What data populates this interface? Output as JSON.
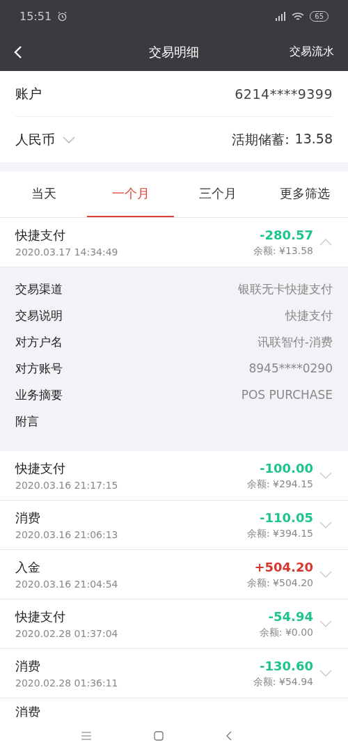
{
  "status_bar": {
    "time": "15:51",
    "battery": "65"
  },
  "header": {
    "title": "交易明细",
    "action": "交易流水"
  },
  "account": {
    "label": "账户",
    "number": "6214****9399",
    "currency": "人民币",
    "balance_label": "活期储蓄:",
    "balance": "13.58"
  },
  "tabs": [
    {
      "label": "当天",
      "selected": false
    },
    {
      "label": "一个月",
      "selected": true
    },
    {
      "label": "三个月",
      "selected": false
    },
    {
      "label": "更多筛选",
      "selected": false
    }
  ],
  "transactions": [
    {
      "title": "快捷支付",
      "time": "2020.03.17 14:34:49",
      "amount": "-280.57",
      "kind": "debit",
      "balance": "余额: ¥13.58",
      "expanded": true,
      "details": [
        {
          "label": "交易渠道",
          "value": "银联无卡快捷支付"
        },
        {
          "label": "交易说明",
          "value": "快捷支付"
        },
        {
          "label": "对方户名",
          "value": "讯联智付-消费"
        },
        {
          "label": "对方账号",
          "value": "8945****0290"
        },
        {
          "label": "业务摘要",
          "value": "POS PURCHASE"
        },
        {
          "label": "附言"
        }
      ]
    },
    {
      "title": "快捷支付",
      "time": "2020.03.16 21:17:15",
      "amount": "-100.00",
      "kind": "debit",
      "balance": "余额: ¥294.15",
      "expanded": false
    },
    {
      "title": "消费",
      "time": "2020.03.16 21:06:13",
      "amount": "-110.05",
      "kind": "debit",
      "balance": "余额: ¥394.15",
      "expanded": false
    },
    {
      "title": "入金",
      "time": "2020.03.16 21:04:54",
      "amount": "+504.20",
      "kind": "credit",
      "balance": "余额: ¥504.20",
      "expanded": false
    },
    {
      "title": "快捷支付",
      "time": "2020.02.28 01:37:04",
      "amount": "-54.94",
      "kind": "debit",
      "balance": "余额: ¥0.00",
      "expanded": false
    },
    {
      "title": "消费",
      "time": "2020.02.28 01:36:11",
      "amount": "-130.60",
      "kind": "debit",
      "balance": "余额: ¥54.94",
      "expanded": false
    },
    {
      "title": "消费"
    }
  ]
}
